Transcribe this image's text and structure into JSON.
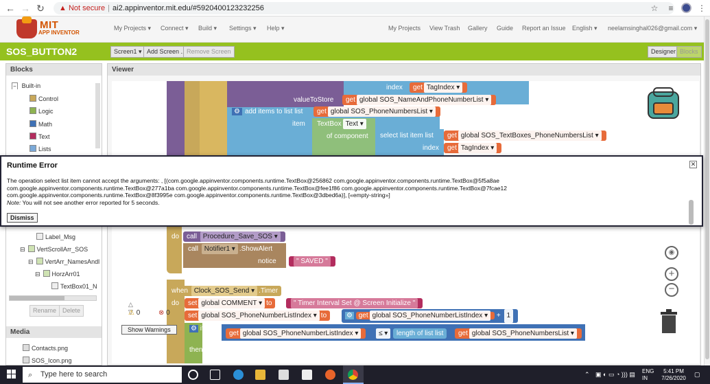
{
  "browser": {
    "security": "Not secure",
    "url": "ai2.appinventor.mit.edu/#5920400123232256"
  },
  "app": {
    "logo_line1": "MIT",
    "logo_line2": "APP INVENTOR",
    "menu_left": [
      "My Projects ▾",
      "Connect ▾",
      "Build ▾",
      "Settings ▾",
      "Help ▾"
    ],
    "menu_right": [
      "My Projects",
      "View Trash",
      "Gallery",
      "Guide",
      "Report an Issue",
      "English ▾",
      "neelamsinghal026@gmail.com ▾"
    ]
  },
  "project": {
    "name": "SOS_BUTTON2",
    "screen": "Screen1 ▾",
    "add_screen": "Add Screen ...",
    "remove_screen": "Remove Screen",
    "designer": "Designer",
    "blocks": "Blocks"
  },
  "blocks_panel": {
    "title": "Blocks",
    "builtin": "Built-in",
    "items": [
      {
        "label": "Control",
        "color": "#c8a85a"
      },
      {
        "label": "Logic",
        "color": "#8eb351"
      },
      {
        "label": "Math",
        "color": "#3f71b5"
      },
      {
        "label": "Text",
        "color": "#b32d5e"
      },
      {
        "label": "Lists",
        "color": "#7ba9d8"
      }
    ],
    "components": [
      "Label_Msg",
      "VertScrollArr_SOS",
      "VertArr_NamesAndl",
      "HorzArr01",
      "TextBox01_N"
    ],
    "rename": "Rename",
    "delete": "Delete"
  },
  "media_panel": {
    "title": "Media",
    "files": [
      "Contacts.png",
      "SOS_Icon.png"
    ]
  },
  "viewer": {
    "title": "Viewer",
    "warn_count": "0",
    "err_count": "0",
    "show_warnings": "Show Warnings"
  },
  "code": {
    "index": "index",
    "get": "get",
    "tagindex": "TagIndex ▾",
    "value_to_store": "valueToStore",
    "global_names": "global SOS_NameAndPhoneNumberList ▾",
    "add_items": "add items to list",
    "list": "list",
    "global_phones": "global SOS_PhoneNumbersList ▾",
    "item": "item",
    "textbox": "TextBox",
    "text_prop": "Text ▾",
    "of_component": "of component",
    "select_list_item": "select list item",
    "global_textboxes": "global SOS_TextBoxes_PhoneNumbersList ▾",
    "do": "do",
    "call": "call",
    "proc_save": "Procedure_Save_SOS ▾",
    "notifier": "Notifier1 ▾",
    "show_alert": ".ShowAlert",
    "notice": "notice",
    "saved": "\" SAVED \"",
    "when": "when",
    "clock": "Clock_SOS_Send ▾",
    "timer": ".Timer",
    "set": "set",
    "global_comment": "global COMMENT ▾",
    "to": "to",
    "timer_text": "\" Timer Interval Set @ Screen Initialize \"",
    "global_index": "global SOS_PhoneNumberListIndex ▾",
    "plus": "+",
    "one": "1",
    "if": "if",
    "le": "≤ ▾",
    "length_of_list": "length of list  list",
    "then": "then"
  },
  "dialog": {
    "title": "Runtime Error",
    "message_lines": [
      "The operation select list item cannot accept the arguments: , [(com.google.appinventor.components.runtime.TextBox@256862 com.google.appinventor.components.runtime.TextBox@5f5a8ae",
      "com.google.appinventor.components.runtime.TextBox@277a1ba com.google.appinventor.components.runtime.TextBox@fee1f86 com.google.appinventor.components.runtime.TextBox@7fcae12",
      "com.google.appinventor.components.runtime.TextBox@8f3995e com.google.appinventor.components.runtime.TextBox@3dbed6a)], [«empty-string»]"
    ],
    "note_label": "Note:",
    "note_text": " You will not see another error reported for 5 seconds.",
    "dismiss": "Dismiss"
  },
  "taskbar": {
    "search_placeholder": "Type here to search",
    "lang": "ENG",
    "region": "IN",
    "time": "5:41 PM",
    "date": "7/26/2020"
  }
}
